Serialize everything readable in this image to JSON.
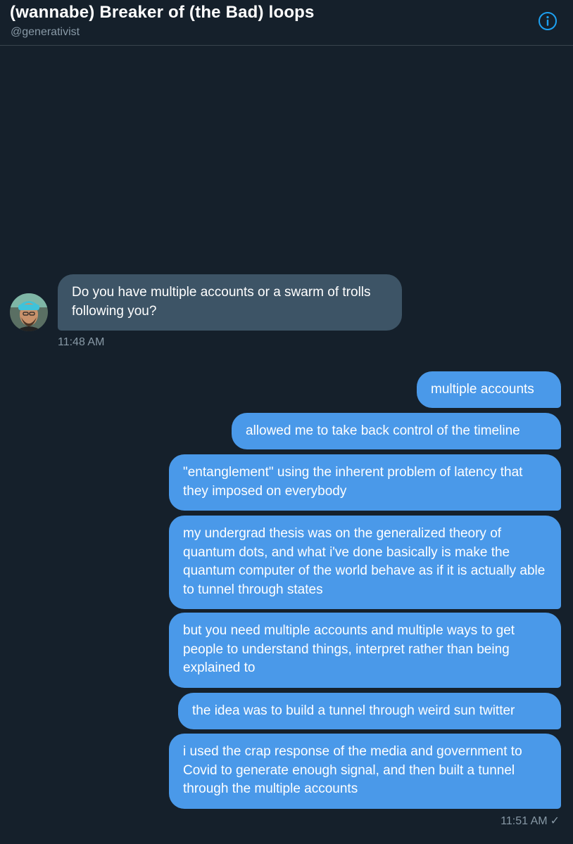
{
  "header": {
    "title": "(wannabe) Breaker of (the Bad) loops",
    "handle": "@generativist",
    "info_icon": "info-circle-icon",
    "accent": "#1da1f2"
  },
  "colors": {
    "background": "#15202b",
    "incoming_bubble": "#3d5466",
    "outgoing_bubble": "#4a99e9",
    "muted_text": "#8899a6"
  },
  "incoming": {
    "avatar": "user-avatar",
    "message": "Do you have multiple accounts or a swarm of trolls following you?",
    "time": "11:48 AM"
  },
  "outgoing": {
    "messages": [
      "multiple accounts",
      "allowed me to take back control of the timeline",
      "\"entanglement\" using the inherent problem of latency that they imposed on everybody",
      "my undergrad thesis was on the generalized theory of quantum dots, and what i've done basically is make the quantum computer of the world behave as if it is actually able to tunnel through states",
      "but you need multiple accounts and multiple ways to get people to understand things, interpret rather than being explained to",
      "the idea was to build a tunnel through weird sun twitter",
      "i used the crap response of the media and government to Covid to generate enough signal, and then built a tunnel through the multiple accounts"
    ],
    "time": "11:51 AM",
    "status_icon": "checkmark-icon"
  }
}
